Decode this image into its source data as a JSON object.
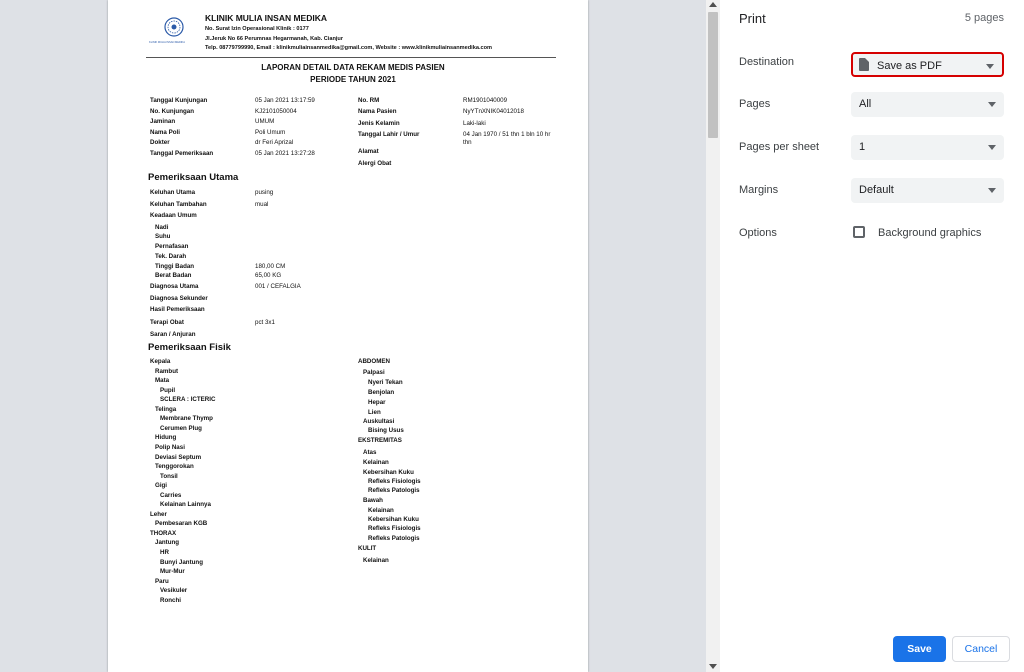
{
  "document": {
    "clinic_name": "KLINIK MULIA INSAN MEDIKA",
    "logo_text": "KLINIK MULIA INSAN MEDIKA",
    "permit": "No. Surat Izin Operasional Klinik : 0177",
    "address": "Jl.Jeruk No 66 Perumnas Hegarmanah, Kab. Cianjur",
    "contact": "Telp. 08779799990, Email : klinikmuliainsanmedika@gmail.com, Website : www.klinikmuliainsanmedika.com",
    "report_title": "LAPORAN DETAIL DATA REKAM MEDIS PASIEN",
    "report_period": "PERIODE TAHUN 2021",
    "info_left": [
      {
        "label": "Tanggal Kunjungan",
        "value": "05 Jan 2021 13:17:59"
      },
      {
        "label": "No. Kunjungan",
        "value": "KJ2101050004"
      },
      {
        "label": "Jaminan",
        "value": "UMUM"
      },
      {
        "label": "Nama Poli",
        "value": "Poli Umum"
      },
      {
        "label": "Dokter",
        "value": "dr Feri Aprizal"
      },
      {
        "label": "Tanggal Pemeriksaan",
        "value": "05 Jan 2021 13:27:28"
      }
    ],
    "info_right": [
      {
        "label": "No. RM",
        "value": "RM1901040009"
      },
      {
        "label": "Nama Pasien",
        "value": "NyYTnXNIK04012018"
      },
      {
        "label": "Jenis Kelamin",
        "value": "Laki-laki"
      },
      {
        "label": "Tanggal Lahir / Umur",
        "value": "04 Jan 1970 / 51 thn 1 bln 10 hr"
      },
      {
        "label": "",
        "value": "thn"
      },
      {
        "label": "Alamat",
        "value": ""
      },
      {
        "label": "Alergi Obat",
        "value": ""
      }
    ],
    "main_exam_title": "Pemeriksaan Utama",
    "main_exam": [
      {
        "label": "Keluhan Utama",
        "value": "pusing"
      },
      {
        "label": "Keluhan Tambahan",
        "value": "mual"
      },
      {
        "label": "Keadaan Umum",
        "value": ""
      },
      {
        "label": "Nadi",
        "value": ""
      },
      {
        "label": "Suhu",
        "value": ""
      },
      {
        "label": "Pernafasan",
        "value": ""
      },
      {
        "label": "Tek. Darah",
        "value": ""
      },
      {
        "label": "Tinggi Badan",
        "value": "180,00 CM"
      },
      {
        "label": "Berat Badan",
        "value": "65,00 KG"
      },
      {
        "label": "Diagnosa Utama",
        "value": "001 / CEFALGIA"
      },
      {
        "label": "Diagnosa Sekunder",
        "value": ""
      },
      {
        "label": "Hasil Pemeriksaan",
        "value": ""
      },
      {
        "label": "Terapi Obat",
        "value": "pct 3x1"
      },
      {
        "label": "Saran / Anjuran",
        "value": ""
      }
    ],
    "physical_exam_title": "Pemeriksaan Fisik",
    "physical_left": [
      "Kepala",
      "Rambut",
      "Mata",
      "Pupil",
      "SCLERA : ICTERIC",
      "Telinga",
      "Membrane Thymp",
      "Cerumen Plug",
      "Hidung",
      "Polip Nasi",
      "Deviasi Septum",
      "Tenggorokan",
      "Tonsil",
      "Gigi",
      "Carries",
      "Kelainan Lainnya",
      "Leher",
      "Pembesaran KGB",
      "THORAX",
      "Jantung",
      "HR",
      "Bunyi Jantung",
      "Mur-Mur",
      "Paru",
      "Vesikuler",
      "Ronchi"
    ],
    "physical_right": [
      "ABDOMEN",
      "Palpasi",
      "Nyeri Tekan",
      "Benjolan",
      "Hepar",
      "Lien",
      "Auskultasi",
      "Bising Usus",
      "EKSTREMITAS",
      "Atas",
      "Kelainan",
      "Kebersihan Kuku",
      "Refleks Fisiologis",
      "Refleks Patologis",
      "Bawah",
      "Kelainan",
      "Kebersihan Kuku",
      "Refleks Fisiologis",
      "Refleks Patologis",
      "KULIT",
      "Kelainan"
    ]
  },
  "settings": {
    "title": "Print",
    "page_count": "5 pages",
    "destination_label": "Destination",
    "destination_value": "Save as PDF",
    "pages_label": "Pages",
    "pages_value": "All",
    "pps_label": "Pages per sheet",
    "pps_value": "1",
    "margins_label": "Margins",
    "margins_value": "Default",
    "options_label": "Options",
    "background_graphics_label": "Background graphics",
    "background_graphics_checked": false,
    "save_label": "Save",
    "cancel_label": "Cancel",
    "accent_color": "#1a73e8",
    "highlight_color": "#d50000"
  }
}
